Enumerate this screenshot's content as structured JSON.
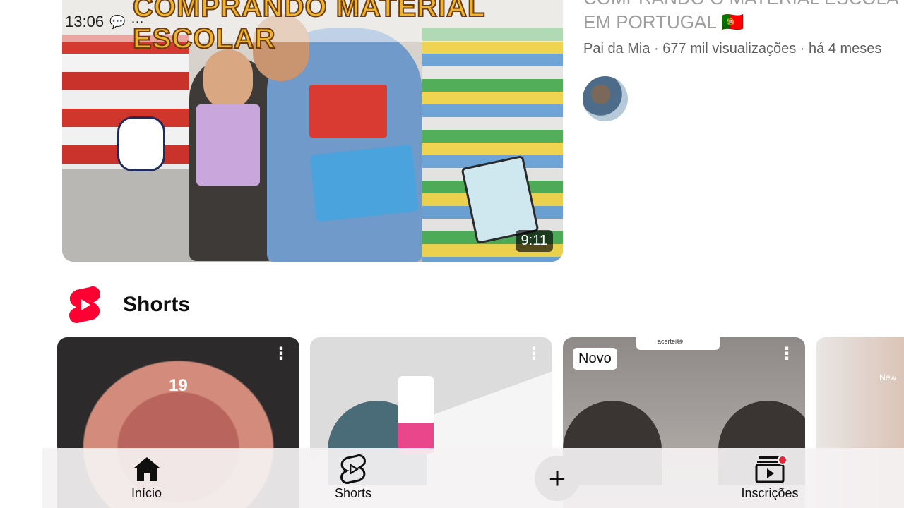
{
  "status_bar": {
    "time": "13:06",
    "icons": [
      "chat-bubble-icon",
      "more-dots-icon"
    ]
  },
  "video": {
    "thumbnail_title": "COMPRANDO MATERIAL ESCOLAR",
    "duration": "9:11",
    "title_line1": "COMPRANDO O MATERIAL ESCOLA",
    "title_line2": "EM PORTUGAL 🇵🇹",
    "meta": "Pai da Mia · 677 mil visualizações · há 4 meses"
  },
  "shorts_section": {
    "title": "Shorts",
    "cards": [
      {
        "overlay_number": "19",
        "menu": "⋮"
      },
      {
        "menu": "⋮"
      },
      {
        "badge": "Novo",
        "caption": "acertei😅",
        "menu": "⋮"
      },
      {
        "overlay_text": "New"
      }
    ]
  },
  "bottom_nav": {
    "items": [
      {
        "label": "Início",
        "icon": "home-icon"
      },
      {
        "label": "Shorts",
        "icon": "shorts-icon"
      },
      {
        "label": "",
        "icon": "add-icon"
      },
      {
        "label": "Inscrições",
        "icon": "subscriptions-icon"
      }
    ],
    "add_symbol": "+"
  },
  "colors": {
    "shorts_red": "#ff0033",
    "notification_red": "#e2263a",
    "text_primary": "#0f0f0f",
    "text_secondary": "#606060"
  }
}
